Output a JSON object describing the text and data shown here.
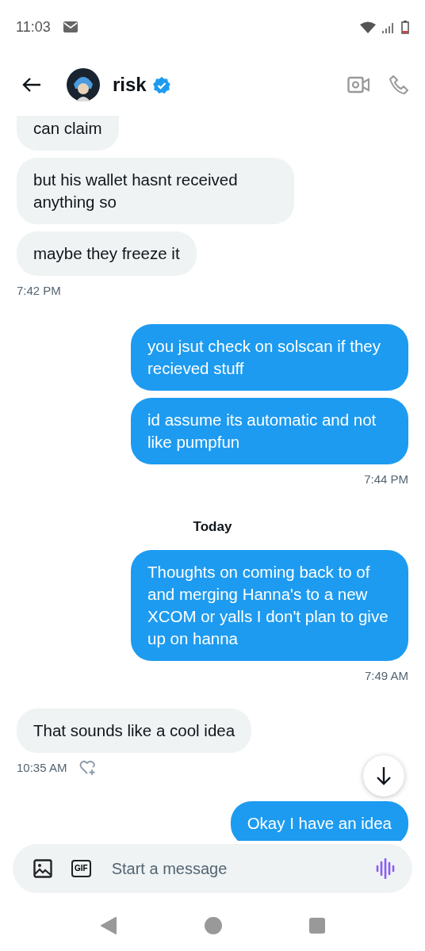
{
  "status_bar": {
    "time": "11:03"
  },
  "header": {
    "name": "risk",
    "verified": true
  },
  "messages": [
    {
      "kind": "incoming",
      "text": "can claim"
    },
    {
      "kind": "incoming",
      "text": "but his wallet hasnt received anything so"
    },
    {
      "kind": "incoming",
      "text": "maybe they freeze it"
    },
    {
      "kind": "incoming-time",
      "text": "7:42 PM"
    },
    {
      "kind": "outgoing",
      "text": "you jsut check on solscan if they recieved stuff"
    },
    {
      "kind": "outgoing",
      "text": "id assume its automatic and not like pumpfun"
    },
    {
      "kind": "outgoing-time",
      "text": "7:44 PM"
    },
    {
      "kind": "day",
      "text": "Today"
    },
    {
      "kind": "outgoing",
      "text": "Thoughts on coming back to of and merging Hanna's to a new XCOM or yalls I don't plan to give up on hanna"
    },
    {
      "kind": "outgoing-time",
      "text": "7:49 AM"
    },
    {
      "kind": "incoming",
      "text": "That sounds like a cool idea"
    },
    {
      "kind": "incoming-time",
      "text": "10:35 AM",
      "add_reaction": true
    },
    {
      "kind": "outgoing",
      "text": "Okay I have an idea"
    }
  ],
  "composer": {
    "placeholder": "Start a message",
    "gif_label": "GIF"
  }
}
